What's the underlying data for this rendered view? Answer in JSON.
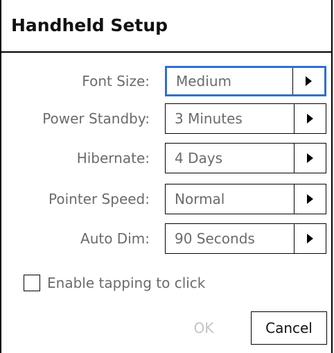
{
  "dialog": {
    "title": "Handheld Setup"
  },
  "settings": [
    {
      "label": "Font Size:",
      "value": "Medium"
    },
    {
      "label": "Power Standby:",
      "value": "3 Minutes"
    },
    {
      "label": "Hibernate:",
      "value": "4 Days"
    },
    {
      "label": "Pointer Speed:",
      "value": "Normal"
    },
    {
      "label": "Auto Dim:",
      "value": "90 Seconds"
    }
  ],
  "tapping": {
    "label": "Enable tapping to click",
    "checked": false
  },
  "buttons": {
    "ok_label": "OK",
    "cancel_label": "Cancel"
  },
  "colors": {
    "focus_border": "#2f6fcf",
    "label_text": "#6b6b6b",
    "disabled_text": "#c4c4c4"
  },
  "icons": {
    "dropdown": "triangle-right-icon"
  }
}
